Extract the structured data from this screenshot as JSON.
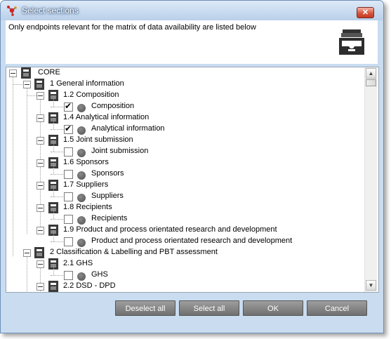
{
  "window": {
    "title": "Select sections",
    "close_glyph": "✕"
  },
  "header": {
    "text": "Only endpoints relevant for the matrix of data availability are listed below",
    "icon": "tray-icon"
  },
  "tree": {
    "root": "CORE",
    "g1": "1 General information",
    "s12": "1.2 Composition",
    "e12": "Composition",
    "s14": "1.4 Analytical information",
    "e14": "Analytical information",
    "s15": "1.5 Joint submission",
    "e15": "Joint submission",
    "s16": "1.6 Sponsors",
    "e16": "Sponsors",
    "s17": "1.7 Suppliers",
    "e17": "Suppliers",
    "s18": "1.8 Recipients",
    "e18": "Recipients",
    "s19": "1.9 Product and process orientated research and development",
    "e19": "Product and process orientated research and development",
    "g2": "2 Classification & Labelling and PBT assessment",
    "s21": "2.1 GHS",
    "e21": "GHS",
    "s22": "2.2 DSD - DPD",
    "checked": {
      "e12": true,
      "e14": true,
      "e15": false,
      "e16": false,
      "e17": false,
      "e18": false,
      "e19": false,
      "e21": false
    },
    "check_glyph": "✔"
  },
  "scrollbar": {
    "up": "▲",
    "down": "▼"
  },
  "buttons": {
    "deselect_all": "Deselect all",
    "select_all": "Select all",
    "ok": "OK",
    "cancel": "Cancel"
  }
}
